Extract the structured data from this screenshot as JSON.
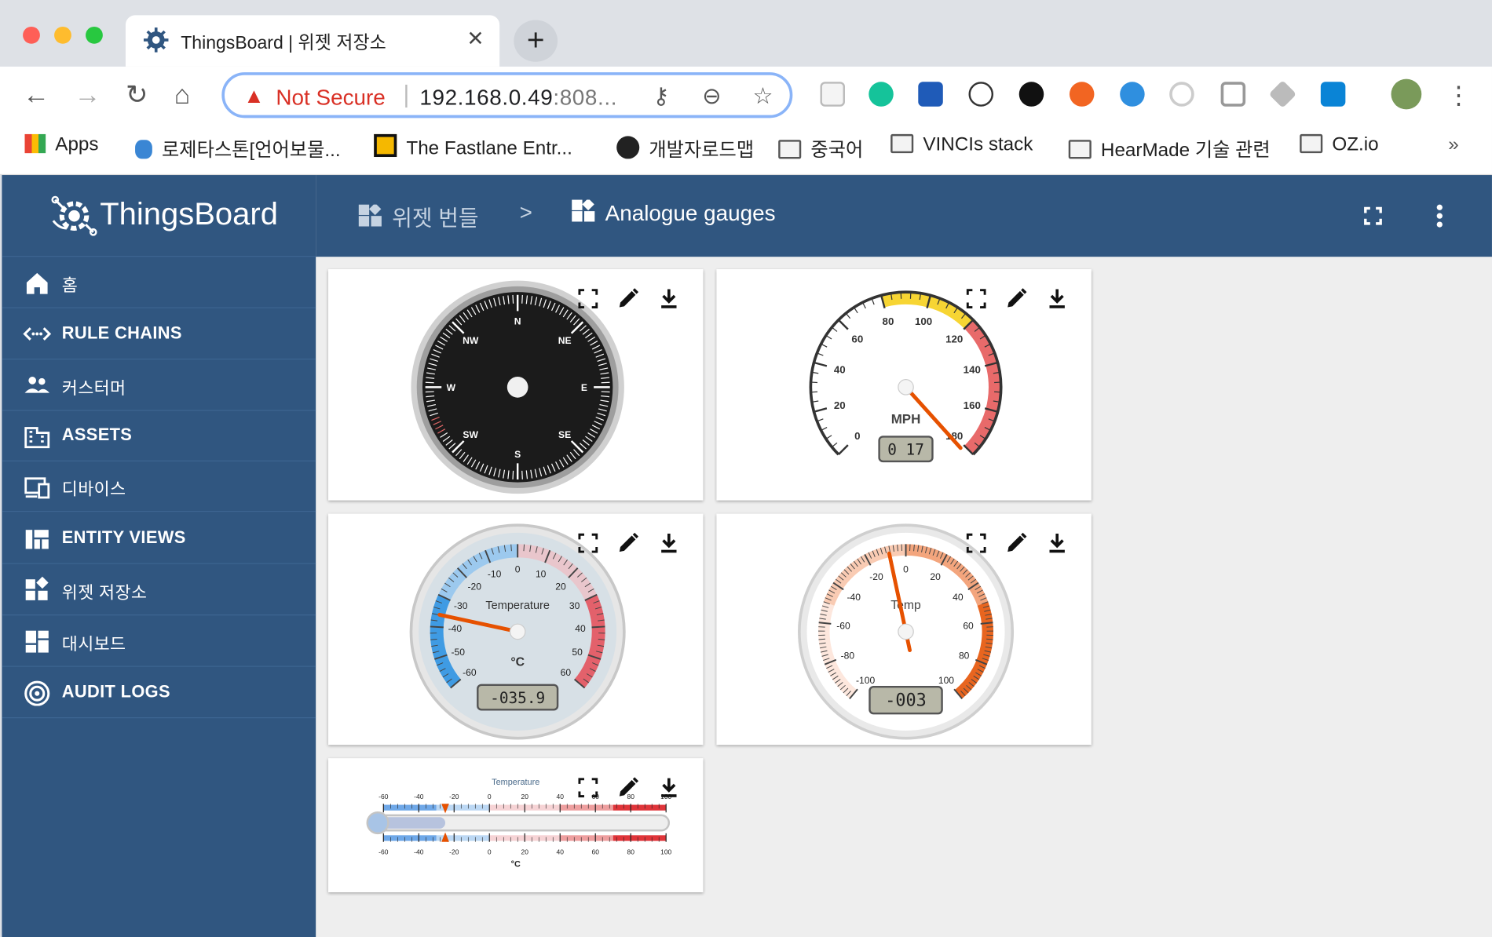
{
  "browser": {
    "tab_title": "ThingsBoard | 위젯 저장소",
    "new_tab_label": "+",
    "security_label": "Not Secure",
    "url": "192.168.0.49",
    "url_suffix": ":808...",
    "bookmarks": [
      "Apps",
      "로제타스톤[언어보물...",
      "The Fastlane Entr...",
      "개발자로드맵",
      "중국어",
      "VINCIs stack",
      "HearMade 기술 관련",
      "OZ.io"
    ],
    "bookmarks_more": "»"
  },
  "app": {
    "logo_text": "ThingsBoard",
    "menu": [
      "홈",
      "RULE CHAINS",
      "커스터머",
      "ASSETS",
      "디바이스",
      "ENTITY VIEWS",
      "위젯 저장소",
      "대시보드",
      "AUDIT LOGS"
    ],
    "breadcrumb": {
      "parent": "위젯 번들",
      "separator": ">",
      "current": "Analogue gauges"
    }
  },
  "widgets": {
    "compass": {
      "directions": [
        "N",
        "NE",
        "E",
        "SE",
        "S",
        "SW",
        "W",
        "NW"
      ],
      "heading_degrees": 0
    },
    "speedometer": {
      "ticks": [
        "0",
        "20",
        "40",
        "60",
        "80",
        "100",
        "120",
        "140",
        "160",
        "180"
      ],
      "min": 0,
      "max": 180,
      "value": 17,
      "units": "MPH",
      "display": "0 17",
      "highlights": [
        {
          "from": 80,
          "to": 120,
          "color": "#f7d533"
        },
        {
          "from": 120,
          "to": 180,
          "color": "#e86a6a"
        }
      ]
    },
    "temperature_radial": {
      "ticks": [
        "-60",
        "-50",
        "-40",
        "-30",
        "-20",
        "-10",
        "0",
        "10",
        "20",
        "30",
        "40",
        "50",
        "60"
      ],
      "min": -60,
      "max": 60,
      "value": -35.9,
      "title": "Temperature",
      "units": "°C",
      "display": "-035.9"
    },
    "temp_gauge": {
      "ticks": [
        "-100",
        "-80",
        "-60",
        "-40",
        "-20",
        "0",
        "20",
        "40",
        "60",
        "80",
        "100"
      ],
      "min": -100,
      "max": 100,
      "value": -3,
      "title": "Temp",
      "display": "-003"
    },
    "thermometer_linear": {
      "title": "Temperature",
      "ticks": [
        "-60",
        "-40",
        "-20",
        "0",
        "20",
        "40",
        "60",
        "80",
        "100"
      ],
      "min": -60,
      "max": 100,
      "value": -25,
      "units": "°C"
    }
  },
  "colors": {
    "primary": "#305680",
    "accent": "#e65100",
    "not_secure": "#d93025"
  }
}
